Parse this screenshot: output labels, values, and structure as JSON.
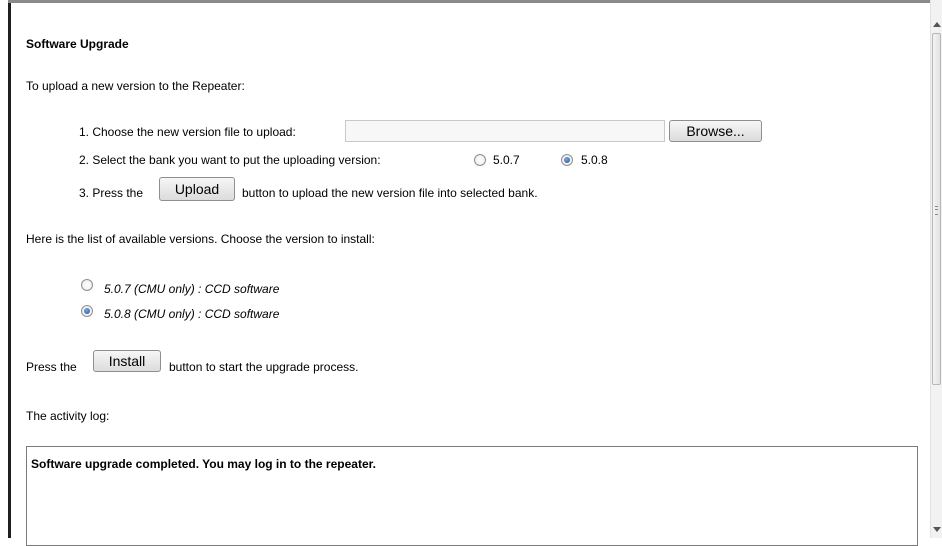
{
  "title": "Software Upgrade",
  "upload": {
    "intro": "To upload a new version to the Repeater:",
    "step1": "1. Choose the new version file to upload:",
    "browse_label": "Browse...",
    "step2": "2. Select the bank you want to put the uploading version:",
    "bank_options": [
      {
        "label": "5.0.7",
        "selected": false
      },
      {
        "label": "5.0.8",
        "selected": true
      }
    ],
    "step3_prefix": "3. Press the",
    "upload_label": "Upload",
    "step3_suffix": "button to upload the new version file into selected bank."
  },
  "versions": {
    "intro": "Here is the list of available versions. Choose the version to install:",
    "items": [
      {
        "label": "5.0.7 (CMU only) : CCD software",
        "selected": false
      },
      {
        "label": "5.0.8 (CMU only) : CCD software",
        "selected": true
      }
    ]
  },
  "install": {
    "prefix": "Press the",
    "button_label": "Install",
    "suffix": "button to start the upgrade process."
  },
  "log": {
    "label": "The activity log:",
    "text": "Software upgrade completed. You may log in to the repeater."
  }
}
